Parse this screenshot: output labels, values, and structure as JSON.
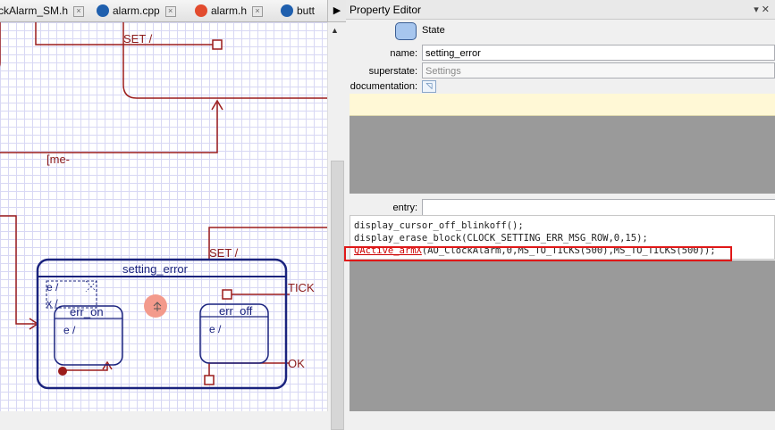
{
  "tabs": [
    {
      "label": "ckAlarm_SM.h",
      "icon": "none"
    },
    {
      "label": "alarm.cpp",
      "icon": "cpp"
    },
    {
      "label": "alarm.h",
      "icon": "h"
    },
    {
      "label": "butt",
      "icon": "cpp"
    }
  ],
  "tab_close_glyph": "×",
  "tab_scroll_glyph": "▶",
  "scroll_up_glyph": "▲",
  "property_editor": {
    "title": "Property Editor",
    "controls": "▾ ✕",
    "kind": "State",
    "name_label": "name:",
    "name_value": "setting_error",
    "superstate_label": "superstate:",
    "superstate_value": "Settings",
    "documentation_label": "documentation:",
    "doc_icon": "◹",
    "entry_label": "entry:",
    "entry_value": "",
    "code_lines": [
      "display_cursor_off_blinkoff();",
      "display_erase_block(CLOCK_SETTING_ERR_MSG_ROW,0,15);"
    ],
    "code_line3_fn": "QActive_armX",
    "code_line3_rest": "(AO_ClockAlarm,0,MS_TO_TICKS(500),MS_TO_TICKS(500));"
  },
  "diagram": {
    "set_label_top": "SET /",
    "guard_label": "[me-",
    "set_label_mid": "SET /",
    "state_title": "setting_error",
    "entry_action": "e /",
    "exit_action": "x /",
    "err_on_title": "err_on",
    "err_on_entry": "e /",
    "err_off_title": "err_off",
    "err_off_entry": "e /",
    "tick_label": "TICK",
    "ok_label": "OK"
  },
  "colors": {
    "state_border": "#1a237e",
    "transition": "#9b1c1c",
    "highlight": "#e01818"
  }
}
